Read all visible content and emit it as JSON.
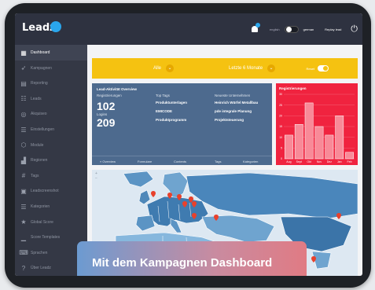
{
  "app": {
    "brand": "Leadz"
  },
  "topbar": {
    "lang_inactive": "english",
    "lang_active": "german",
    "user": "Replay lead",
    "power_icon": "⏻"
  },
  "sidebar": {
    "items": [
      {
        "label": "Dashboard",
        "icon": "grid-icon",
        "glyph": "▦"
      },
      {
        "label": "Kampagnen",
        "icon": "rocket-icon",
        "glyph": "➶"
      },
      {
        "label": "Reporting",
        "icon": "chart-icon",
        "glyph": "▤"
      },
      {
        "label": "Leads",
        "icon": "leads-icon",
        "glyph": "☷"
      },
      {
        "label": "Akquiseo",
        "icon": "target-icon",
        "glyph": "◎"
      },
      {
        "label": "Einstellungen",
        "icon": "settings-icon",
        "glyph": "☰"
      },
      {
        "label": "Module",
        "icon": "module-icon",
        "glyph": "⬡"
      },
      {
        "label": "Regionen",
        "icon": "region-icon",
        "glyph": "▟"
      },
      {
        "label": "Tags",
        "icon": "hash-icon",
        "glyph": "#"
      },
      {
        "label": "Leadscreenshot",
        "icon": "screenshot-icon",
        "glyph": "▣"
      },
      {
        "label": "Kategorien",
        "icon": "list-icon",
        "glyph": "☰"
      },
      {
        "label": "Global Score",
        "icon": "star-icon",
        "glyph": "★"
      },
      {
        "label": "Score Templates",
        "icon": "bar-icon",
        "glyph": "▁"
      },
      {
        "label": "Sprachen",
        "icon": "language-icon",
        "glyph": "⌨"
      },
      {
        "label": "Über Leadz",
        "icon": "question-icon",
        "glyph": "?"
      }
    ]
  },
  "filters": {
    "all": "Alle",
    "period": "Letzte 6 Monate",
    "reset": "Reset"
  },
  "overview": {
    "title": "Lead-Aktivität Overview",
    "registrations_label": "Registrierungen",
    "registrations_value": "102",
    "logins_label": "Logins",
    "logins_value": "209",
    "top_tags_label": "Top Tags",
    "top_tags": [
      "Produktunterlagen",
      "EMICODE",
      "Produktprogramm"
    ],
    "companies_label": "Neueste Unternehmen",
    "companies": [
      "Heinrich Würfel Metallbau",
      "pde integrale Planung",
      "Projektsteuerung"
    ],
    "tabs": [
      "« Overview",
      "Formulare",
      "Contents",
      "Tags",
      "Kategorien"
    ]
  },
  "registrations_chart": {
    "title": "Registrierungen",
    "colors": {
      "bg": "#f0233f",
      "bar": "#f88a98",
      "bar_stroke": "#ffffff"
    }
  },
  "chart_data": {
    "type": "bar",
    "title": "Registrierungen",
    "categories": [
      "Aug",
      "Sept",
      "Okt",
      "Nov",
      "Dez",
      "Jan",
      "Feb"
    ],
    "values": [
      11,
      16,
      26,
      15,
      11,
      20,
      3
    ],
    "ylim": [
      0,
      30
    ],
    "yticks": [
      0,
      5,
      10,
      15,
      20,
      25,
      30
    ],
    "grid": true
  },
  "banner": {
    "text": "Mit dem Kampagnen Dashboard"
  },
  "colors": {
    "accent": "#f5c211",
    "topbar": "#2e3240",
    "sidebar": "#343845",
    "panel": "#4d6a8e",
    "map_water": "#dde8f2",
    "map_land": "#5b94c4",
    "marker": "#e8412c"
  }
}
